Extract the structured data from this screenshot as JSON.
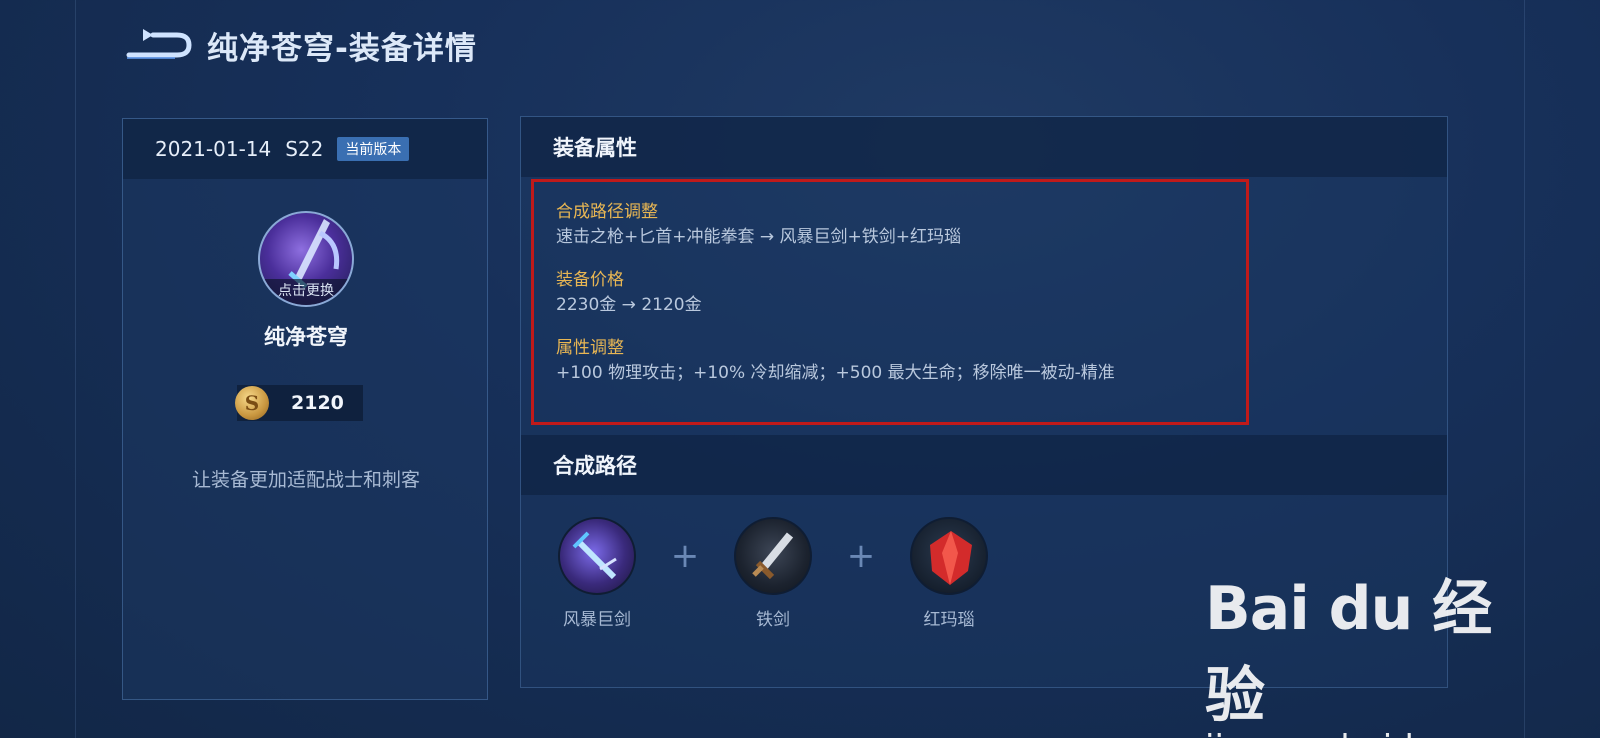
{
  "header": {
    "title": "纯净苍穹-装备详情"
  },
  "left": {
    "date": "2021-01-14",
    "season": "S22",
    "badge": "当前版本",
    "avatar_caption": "点击更换",
    "item_name": "纯净苍穹",
    "price": "2120",
    "description": "让装备更加适配战士和刺客"
  },
  "attributes": {
    "section_title": "装备属性",
    "items": [
      {
        "label": "合成路径调整",
        "value": "速击之枪+匕首+冲能拳套 → 风暴巨剑+铁剑+红玛瑙"
      },
      {
        "label": "装备价格",
        "value": "2230金 → 2120金"
      },
      {
        "label": "属性调整",
        "value": "+100 物理攻击；+10% 冷却缩减；+500 最大生命；移除唯一被动-精准"
      }
    ],
    "highlight_color": "#c01a1a",
    "label_color": "#e8b653"
  },
  "recipe": {
    "section_title": "合成路径",
    "plus": "+",
    "items": [
      {
        "name": "风暴巨剑",
        "icon": "storm-sword-icon"
      },
      {
        "name": "铁剑",
        "icon": "iron-sword-icon"
      },
      {
        "name": "红玛瑙",
        "icon": "red-agate-icon"
      }
    ]
  },
  "watermark": {
    "logo": "Bai du 经验",
    "url": "jingyan.baidu.com"
  }
}
